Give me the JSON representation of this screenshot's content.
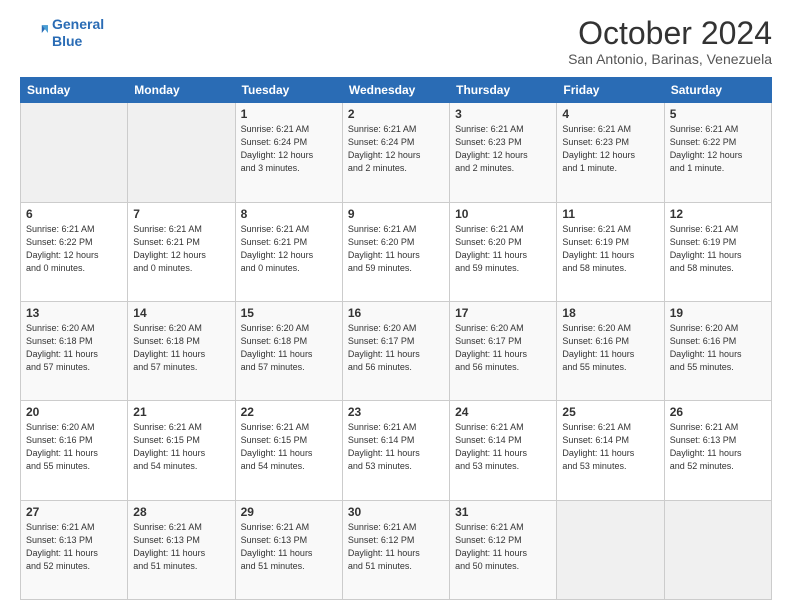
{
  "logo": {
    "line1": "General",
    "line2": "Blue"
  },
  "title": "October 2024",
  "subtitle": "San Antonio, Barinas, Venezuela",
  "days_header": [
    "Sunday",
    "Monday",
    "Tuesday",
    "Wednesday",
    "Thursday",
    "Friday",
    "Saturday"
  ],
  "weeks": [
    [
      {
        "day": "",
        "info": ""
      },
      {
        "day": "",
        "info": ""
      },
      {
        "day": "1",
        "info": "Sunrise: 6:21 AM\nSunset: 6:24 PM\nDaylight: 12 hours\nand 3 minutes."
      },
      {
        "day": "2",
        "info": "Sunrise: 6:21 AM\nSunset: 6:24 PM\nDaylight: 12 hours\nand 2 minutes."
      },
      {
        "day": "3",
        "info": "Sunrise: 6:21 AM\nSunset: 6:23 PM\nDaylight: 12 hours\nand 2 minutes."
      },
      {
        "day": "4",
        "info": "Sunrise: 6:21 AM\nSunset: 6:23 PM\nDaylight: 12 hours\nand 1 minute."
      },
      {
        "day": "5",
        "info": "Sunrise: 6:21 AM\nSunset: 6:22 PM\nDaylight: 12 hours\nand 1 minute."
      }
    ],
    [
      {
        "day": "6",
        "info": "Sunrise: 6:21 AM\nSunset: 6:22 PM\nDaylight: 12 hours\nand 0 minutes."
      },
      {
        "day": "7",
        "info": "Sunrise: 6:21 AM\nSunset: 6:21 PM\nDaylight: 12 hours\nand 0 minutes."
      },
      {
        "day": "8",
        "info": "Sunrise: 6:21 AM\nSunset: 6:21 PM\nDaylight: 12 hours\nand 0 minutes."
      },
      {
        "day": "9",
        "info": "Sunrise: 6:21 AM\nSunset: 6:20 PM\nDaylight: 11 hours\nand 59 minutes."
      },
      {
        "day": "10",
        "info": "Sunrise: 6:21 AM\nSunset: 6:20 PM\nDaylight: 11 hours\nand 59 minutes."
      },
      {
        "day": "11",
        "info": "Sunrise: 6:21 AM\nSunset: 6:19 PM\nDaylight: 11 hours\nand 58 minutes."
      },
      {
        "day": "12",
        "info": "Sunrise: 6:21 AM\nSunset: 6:19 PM\nDaylight: 11 hours\nand 58 minutes."
      }
    ],
    [
      {
        "day": "13",
        "info": "Sunrise: 6:20 AM\nSunset: 6:18 PM\nDaylight: 11 hours\nand 57 minutes."
      },
      {
        "day": "14",
        "info": "Sunrise: 6:20 AM\nSunset: 6:18 PM\nDaylight: 11 hours\nand 57 minutes."
      },
      {
        "day": "15",
        "info": "Sunrise: 6:20 AM\nSunset: 6:18 PM\nDaylight: 11 hours\nand 57 minutes."
      },
      {
        "day": "16",
        "info": "Sunrise: 6:20 AM\nSunset: 6:17 PM\nDaylight: 11 hours\nand 56 minutes."
      },
      {
        "day": "17",
        "info": "Sunrise: 6:20 AM\nSunset: 6:17 PM\nDaylight: 11 hours\nand 56 minutes."
      },
      {
        "day": "18",
        "info": "Sunrise: 6:20 AM\nSunset: 6:16 PM\nDaylight: 11 hours\nand 55 minutes."
      },
      {
        "day": "19",
        "info": "Sunrise: 6:20 AM\nSunset: 6:16 PM\nDaylight: 11 hours\nand 55 minutes."
      }
    ],
    [
      {
        "day": "20",
        "info": "Sunrise: 6:20 AM\nSunset: 6:16 PM\nDaylight: 11 hours\nand 55 minutes."
      },
      {
        "day": "21",
        "info": "Sunrise: 6:21 AM\nSunset: 6:15 PM\nDaylight: 11 hours\nand 54 minutes."
      },
      {
        "day": "22",
        "info": "Sunrise: 6:21 AM\nSunset: 6:15 PM\nDaylight: 11 hours\nand 54 minutes."
      },
      {
        "day": "23",
        "info": "Sunrise: 6:21 AM\nSunset: 6:14 PM\nDaylight: 11 hours\nand 53 minutes."
      },
      {
        "day": "24",
        "info": "Sunrise: 6:21 AM\nSunset: 6:14 PM\nDaylight: 11 hours\nand 53 minutes."
      },
      {
        "day": "25",
        "info": "Sunrise: 6:21 AM\nSunset: 6:14 PM\nDaylight: 11 hours\nand 53 minutes."
      },
      {
        "day": "26",
        "info": "Sunrise: 6:21 AM\nSunset: 6:13 PM\nDaylight: 11 hours\nand 52 minutes."
      }
    ],
    [
      {
        "day": "27",
        "info": "Sunrise: 6:21 AM\nSunset: 6:13 PM\nDaylight: 11 hours\nand 52 minutes."
      },
      {
        "day": "28",
        "info": "Sunrise: 6:21 AM\nSunset: 6:13 PM\nDaylight: 11 hours\nand 51 minutes."
      },
      {
        "day": "29",
        "info": "Sunrise: 6:21 AM\nSunset: 6:13 PM\nDaylight: 11 hours\nand 51 minutes."
      },
      {
        "day": "30",
        "info": "Sunrise: 6:21 AM\nSunset: 6:12 PM\nDaylight: 11 hours\nand 51 minutes."
      },
      {
        "day": "31",
        "info": "Sunrise: 6:21 AM\nSunset: 6:12 PM\nDaylight: 11 hours\nand 50 minutes."
      },
      {
        "day": "",
        "info": ""
      },
      {
        "day": "",
        "info": ""
      }
    ]
  ]
}
